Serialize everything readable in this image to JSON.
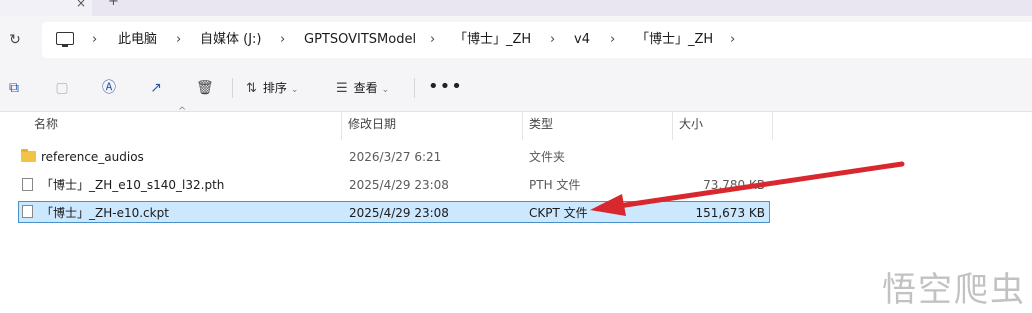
{
  "tabstrip": {
    "close_glyph": "×",
    "new_tab_glyph": "+"
  },
  "address_bar": {
    "refresh_icon": "refresh-icon",
    "device_icon": "computer-icon",
    "breadcrumbs": [
      "此电脑",
      "自媒体 (J:)",
      "GPTSOVITSModel",
      "「博士」_ZH",
      "v4",
      "「博士」_ZH"
    ],
    "separator": "›"
  },
  "toolbar": {
    "icons": [
      "copy-icon",
      "paste-icon",
      "rename-icon",
      "share-icon",
      "delete-icon"
    ],
    "sort_label": "排序",
    "view_label": "查看",
    "more_label": "•••"
  },
  "columns": {
    "name": "名称",
    "modified": "修改日期",
    "type": "类型",
    "size": "大小"
  },
  "files": [
    {
      "name": "reference_audios",
      "modified": "2026/3/27 6:21",
      "type": "文件夹",
      "size": "",
      "kind": "folder",
      "selected": false
    },
    {
      "name": "「博士」_ZH_e10_s140_l32.pth",
      "modified": "2025/4/29 23:08",
      "type": "PTH 文件",
      "size": "73,780 KB",
      "kind": "file",
      "selected": false
    },
    {
      "name": "「博士」_ZH-e10.ckpt",
      "modified": "2025/4/29 23:08",
      "type": "CKPT 文件",
      "size": "151,673 KB",
      "kind": "file",
      "selected": true
    }
  ],
  "annotation": {
    "color": "#d9272e"
  },
  "colors": {
    "selection_bg": "#cce8ff",
    "selection_border": "#4a90c9",
    "accent": "#2b59a8"
  },
  "watermark": "悟空爬虫"
}
